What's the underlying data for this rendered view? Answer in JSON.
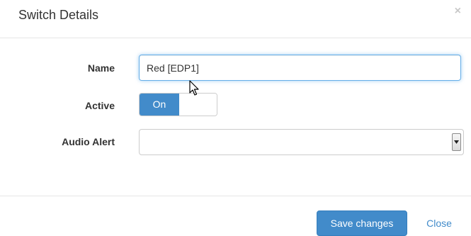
{
  "modal": {
    "title": "Switch Details",
    "close_symbol": "×"
  },
  "form": {
    "name_label": "Name",
    "name_value": "Red [EDP1]",
    "active_label": "Active",
    "active_toggle_on_label": "On",
    "active_state": "on",
    "audio_alert_label": "Audio Alert",
    "audio_alert_value": ""
  },
  "footer": {
    "save_label": "Save changes",
    "close_label": "Close"
  },
  "colors": {
    "primary": "#428bca",
    "focus_border": "#66afe9",
    "close_icon": "#c8c8c8"
  },
  "icons": {
    "close": "close-icon",
    "dropdown": "chevron-down-icon",
    "cursor": "mouse-pointer-icon"
  }
}
